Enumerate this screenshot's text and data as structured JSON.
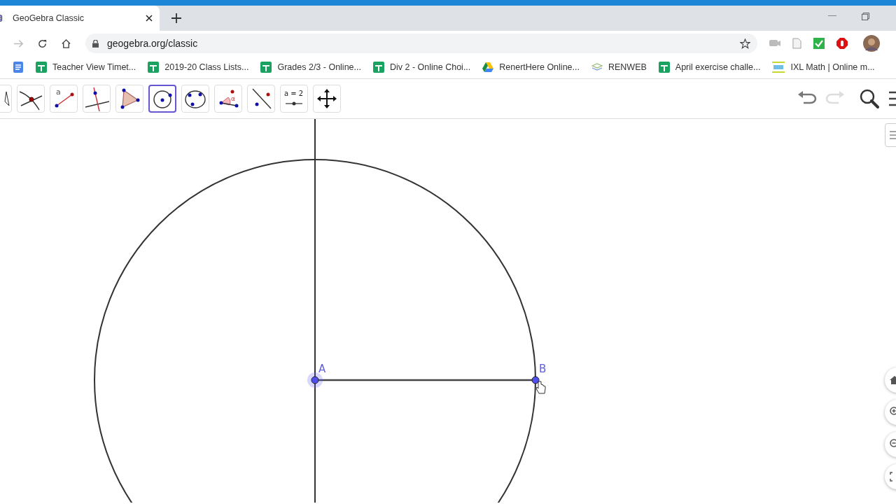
{
  "browser": {
    "tab": {
      "title": "GeoGebra Classic",
      "selected": true
    },
    "url": "geogebra.org/classic",
    "bookmarks": [
      {
        "kind": "docs"
      },
      {
        "kind": "sheets",
        "label": "Teacher View Timet..."
      },
      {
        "kind": "sheets",
        "label": "2019-20 Class Lists..."
      },
      {
        "kind": "sheets",
        "label": "Grades 2/3 - Online..."
      },
      {
        "kind": "sheets",
        "label": "Div 2 - Online Choi..."
      },
      {
        "kind": "drive",
        "label": "RenertHere Online..."
      },
      {
        "kind": "renweb",
        "label": "RENWEB"
      },
      {
        "kind": "sheets",
        "label": "April exercise challe..."
      },
      {
        "kind": "ixl",
        "label": "IXL Math | Online m..."
      }
    ]
  },
  "toolbar": {
    "tools": [
      {
        "kind": "move",
        "selected": false
      },
      {
        "kind": "intersect",
        "selected": false
      },
      {
        "kind": "segment",
        "label": "a",
        "selected": false
      },
      {
        "kind": "perpendicular",
        "selected": false
      },
      {
        "kind": "polygon",
        "selected": false
      },
      {
        "kind": "circle",
        "selected": true
      },
      {
        "kind": "ellipse",
        "selected": false
      },
      {
        "kind": "angle",
        "label": "α",
        "selected": false
      },
      {
        "kind": "reflect",
        "selected": false
      },
      {
        "kind": "slider",
        "label": "a = 2",
        "selected": false
      },
      {
        "kind": "move-view",
        "selected": false
      }
    ],
    "redo_disabled": true
  },
  "construction": {
    "points": [
      {
        "label": "A",
        "selected": true
      },
      {
        "label": "B",
        "selected": false
      }
    ]
  }
}
